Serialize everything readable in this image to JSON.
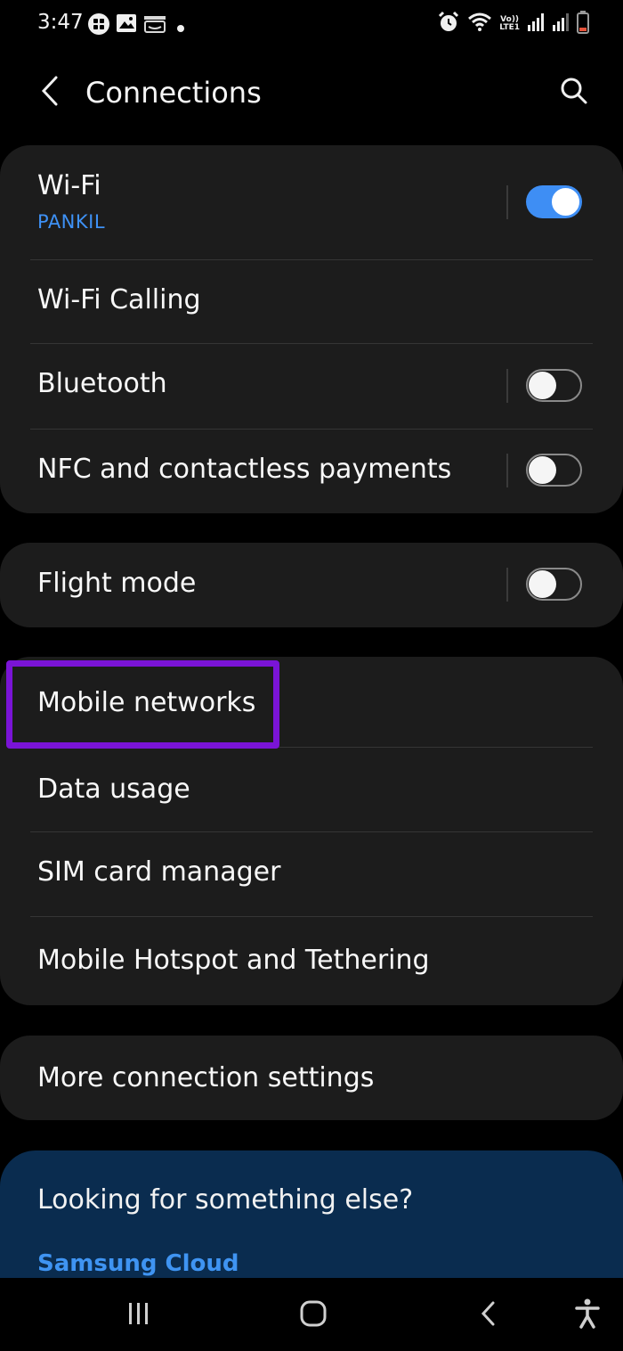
{
  "status_bar": {
    "time": "3:47",
    "left_icons": [
      "extension-icon",
      "gallery-icon",
      "amazon-icon",
      "dot-icon"
    ],
    "right_icons": [
      "alarm-icon",
      "wifi-calling-icon",
      "volte-lte-icon",
      "signal-icon",
      "signal-icon",
      "battery-icon"
    ],
    "volte_label": "Vo))",
    "lte_label": "LTE1"
  },
  "header": {
    "title": "Connections",
    "back_icon": "chevron-left-icon",
    "search_icon": "search-icon"
  },
  "groups": [
    {
      "items": [
        {
          "label": "Wi-Fi",
          "subtitle": "PANKIL",
          "toggle": true
        },
        {
          "label": "Wi-Fi Calling"
        },
        {
          "label": "Bluetooth",
          "toggle": false
        },
        {
          "label": "NFC and contactless payments",
          "toggle": false
        }
      ]
    },
    {
      "items": [
        {
          "label": "Flight mode",
          "toggle": false
        }
      ]
    },
    {
      "items": [
        {
          "label": "Mobile networks",
          "highlighted": true
        },
        {
          "label": "Data usage"
        },
        {
          "label": "SIM card manager"
        },
        {
          "label": "Mobile Hotspot and Tethering"
        }
      ]
    },
    {
      "items": [
        {
          "label": "More connection settings"
        }
      ]
    }
  ],
  "suggestion": {
    "title": "Looking for something else?",
    "link": "Samsung Cloud"
  },
  "nav_bar": {
    "icons": [
      "recent-apps-icon",
      "home-icon",
      "back-icon",
      "accessibility-icon"
    ]
  },
  "colors": {
    "background": "#000000",
    "card": "#1c1c1c",
    "accent_blue": "#3e8ef4",
    "highlight": "#7a14d6",
    "suggestion_bg": "#0a2c4f"
  }
}
